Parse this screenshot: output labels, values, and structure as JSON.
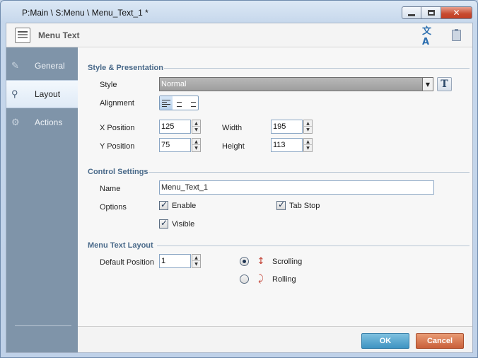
{
  "window": {
    "title": "P:Main \\ S:Menu \\ Menu_Text_1 *",
    "min_label": "",
    "max_label": "",
    "close_label": "✕"
  },
  "header": {
    "title": "Menu Text",
    "icons": [
      "menu-text-icon",
      "translate-icon",
      "clipboard-icon"
    ]
  },
  "sidebar": {
    "items": [
      {
        "label": "General",
        "icon": "pencil-icon",
        "active": false
      },
      {
        "label": "Layout",
        "icon": "magnifier-icon",
        "active": true
      },
      {
        "label": "Actions",
        "icon": "actions-icon",
        "active": false
      }
    ]
  },
  "style_presentation": {
    "section_title": "Style & Presentation",
    "style_label": "Style",
    "style_value": "Normal",
    "font_button_label": "T",
    "alignment_label": "Alignment",
    "alignment_selected": "left",
    "x_label": "X Position",
    "x_value": "125",
    "y_label": "Y Position",
    "y_value": "75",
    "width_label": "Width",
    "width_value": "195",
    "height_label": "Height",
    "height_value": "113"
  },
  "control_settings": {
    "section_title": "Control Settings",
    "name_label": "Name",
    "name_value": "Menu_Text_1",
    "options_label": "Options",
    "enable_label": "Enable",
    "enable_checked": true,
    "tabstop_label": "Tab Stop",
    "tabstop_checked": true,
    "visible_label": "Visible",
    "visible_checked": true
  },
  "menu_text_layout": {
    "section_title": "Menu Text Layout",
    "default_position_label": "Default Position",
    "default_position_value": "1",
    "scrolling_label": "Scrolling",
    "scrolling_selected": true,
    "rolling_label": "Rolling",
    "rolling_selected": false
  },
  "footer": {
    "ok_label": "OK",
    "cancel_label": "Cancel"
  },
  "colors": {
    "accent": "#3f94c2",
    "cancel": "#c9603a",
    "sidebar": "#7f94a9",
    "section_title": "#4a6a8a"
  }
}
